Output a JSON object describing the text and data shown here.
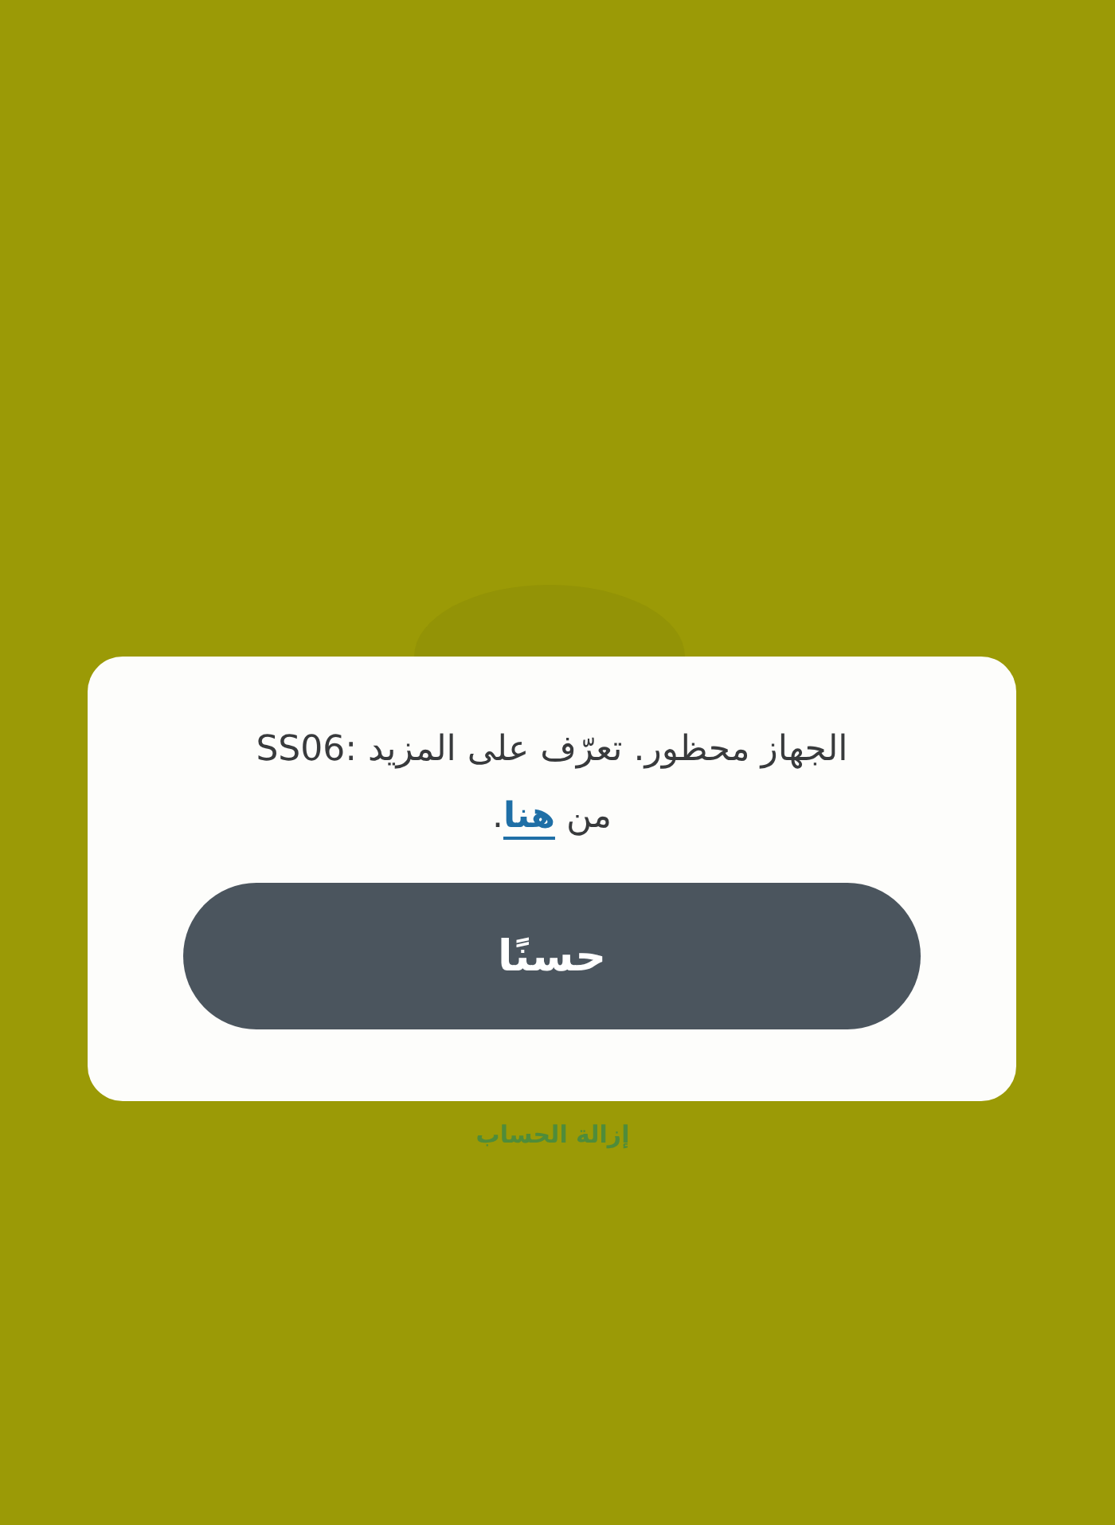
{
  "dialog": {
    "message": {
      "text": "الجهاز محظور. تعرّف على المزيد :SS06 من",
      "link": "هنا",
      "text_after": "."
    },
    "button": "حسنًا"
  },
  "background": {
    "link": "إزالة الحساب"
  }
}
